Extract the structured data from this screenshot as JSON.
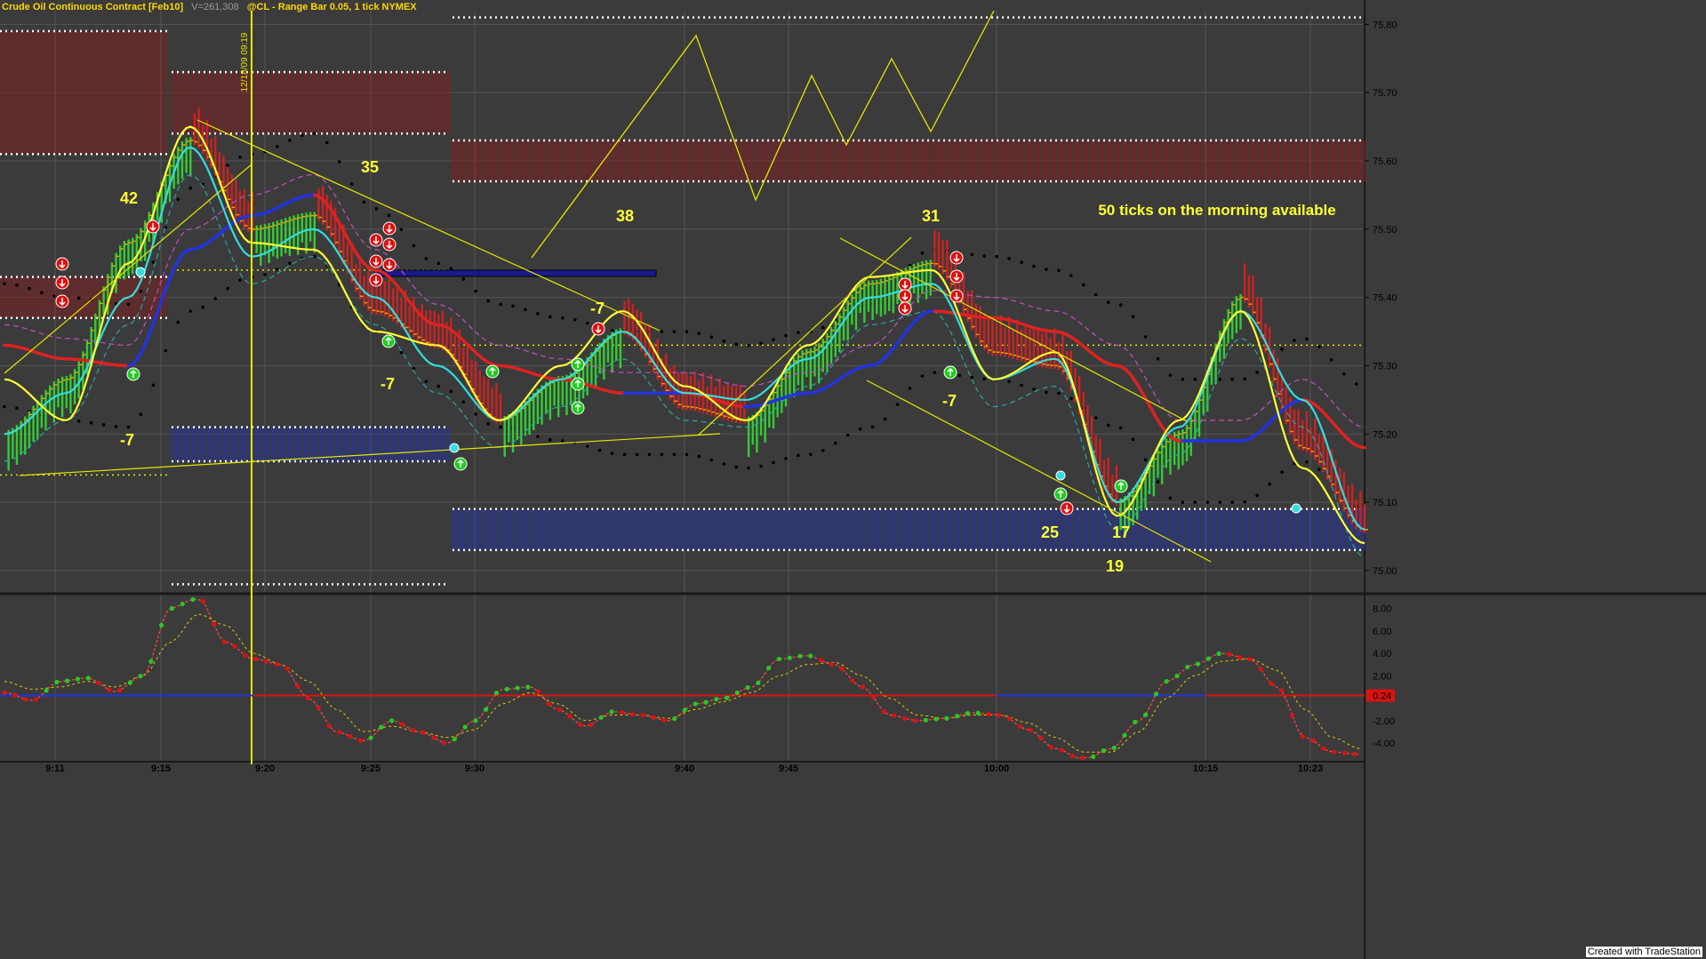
{
  "header": {
    "symbol_title": "Crude Oil Continuous Contract [Feb10]",
    "volume": "V=261,308",
    "instrument": "@CL - Range Bar 0.05, 1 tick  NYMEX"
  },
  "marker_date": "12/18/09 09:19",
  "footer": "Created with TradeStation",
  "annotation": "50 ticks on the morning available",
  "colors": {
    "background": "#3b3b3b",
    "up_bar": "#33cc33",
    "down_bar": "#cc2222",
    "price_tick": "#f0a000",
    "fast_ma": "#ffff33",
    "mid_ma": "#33dddd",
    "slow_ma_up": "#2233dd",
    "slow_ma_down": "#dd2222",
    "envelope": "#000000",
    "supply_zone": "#8b1a1a",
    "demand_zone": "#2233aa",
    "trendline": "#e6e600",
    "text": "#ffff33"
  },
  "chart_data": [
    {
      "type": "candlestick",
      "title": "Crude Oil Continuous Contract [Feb10]",
      "x_ticks": [
        "9:11",
        "9:15",
        "9:20",
        "9:25",
        "9:30",
        "9:40",
        "9:45",
        "10:00",
        "10:15",
        "10:23"
      ],
      "y_ticks": [
        "75.80",
        "75.70",
        "75.60",
        "75.50",
        "75.40",
        "75.30",
        "75.20",
        "75.10",
        "75.00"
      ],
      "ylim": [
        74.97,
        75.82
      ],
      "grid": true,
      "series": [
        {
          "name": "Price",
          "x": [
            "9:11",
            "9:13",
            "9:15",
            "9:17",
            "9:19",
            "9:21",
            "9:23",
            "9:25",
            "9:28",
            "9:30",
            "9:34",
            "9:37",
            "9:40",
            "9:43",
            "9:45",
            "9:50",
            "9:55",
            "10:00",
            "10:05",
            "10:10",
            "10:15",
            "10:20",
            "10:23"
          ],
          "close": [
            75.2,
            75.28,
            75.48,
            75.63,
            75.5,
            75.52,
            75.38,
            75.33,
            75.22,
            75.28,
            75.35,
            75.24,
            75.22,
            75.32,
            75.42,
            75.45,
            75.32,
            75.3,
            75.1,
            75.2,
            75.4,
            75.18,
            75.06
          ]
        },
        {
          "name": "Fast MA",
          "values": [
            75.28,
            75.22,
            75.45,
            75.65,
            75.48,
            75.47,
            75.35,
            75.33,
            75.22,
            75.3,
            75.38,
            75.27,
            75.22,
            75.33,
            75.43,
            75.44,
            75.28,
            75.32,
            75.08,
            75.22,
            75.38,
            75.15,
            75.04
          ]
        },
        {
          "name": "Mid MA",
          "values": [
            75.2,
            75.26,
            75.4,
            75.62,
            75.46,
            75.5,
            75.4,
            75.3,
            75.22,
            75.28,
            75.35,
            75.26,
            75.25,
            75.31,
            75.4,
            75.42,
            75.28,
            75.31,
            75.1,
            75.21,
            75.38,
            75.25,
            75.06
          ]
        },
        {
          "name": "Slow MA",
          "values": [
            75.33,
            75.31,
            75.3,
            75.47,
            75.52,
            75.55,
            75.44,
            75.36,
            75.3,
            75.28,
            75.26,
            75.26,
            75.24,
            75.26,
            75.3,
            75.38,
            75.37,
            75.35,
            75.3,
            75.19,
            75.19,
            75.25,
            75.18
          ]
        }
      ],
      "zones": [
        {
          "kind": "supply",
          "range": [
            75.61,
            75.79
          ]
        },
        {
          "kind": "supply",
          "range": [
            75.64,
            75.73
          ]
        },
        {
          "kind": "supply",
          "range": [
            75.57,
            75.63
          ]
        },
        {
          "kind": "supply",
          "range": [
            75.37,
            75.43
          ]
        },
        {
          "kind": "demand",
          "range": [
            75.16,
            75.21
          ]
        },
        {
          "kind": "demand",
          "range": [
            75.03,
            75.09
          ]
        }
      ],
      "annotations": [
        "42",
        "35",
        "38",
        "31",
        "-7",
        "-7",
        "-7",
        "-7",
        "25",
        "17",
        "19",
        "50 ticks on the morning available"
      ]
    },
    {
      "type": "line",
      "title": "",
      "y_ticks": [
        "8.00",
        "6.00",
        "4.00",
        "2.00",
        "0.24",
        "-2.00",
        "-4.00"
      ],
      "ylim": [
        -5.5,
        9
      ],
      "zero_line": 0.24,
      "series": [
        {
          "name": "Oscillator",
          "values": [
            0.5,
            -0.2,
            1.5,
            1.8,
            0.6,
            2.0,
            8.0,
            9.0,
            5.0,
            3.5,
            3.0,
            0.0,
            -3.0,
            -3.8,
            -2.0,
            -3.0,
            -4.0,
            -2.0,
            0.8,
            1.0,
            -1.0,
            -2.5,
            -1.2,
            -1.5,
            -2.0,
            -0.5,
            0.0,
            1.0,
            3.5,
            3.8,
            3.0,
            1.0,
            -1.5,
            -2.0,
            -1.8,
            -1.3,
            -1.5,
            -2.8,
            -4.5,
            -5.5,
            -4.5,
            -2.0,
            1.5,
            3.0,
            4.0,
            3.5,
            1.0,
            -3.5,
            -4.8,
            -5.0
          ]
        },
        {
          "name": "Signal",
          "values": [
            1.5,
            0.8,
            1.0,
            1.5,
            1.0,
            2.0,
            5.0,
            7.5,
            6.5,
            4.0,
            3.0,
            1.5,
            -1.0,
            -3.0,
            -2.5,
            -3.0,
            -3.5,
            -2.8,
            -0.5,
            0.5,
            -0.5,
            -2.0,
            -1.5,
            -1.5,
            -1.8,
            -1.0,
            -0.3,
            0.5,
            2.0,
            3.0,
            3.2,
            2.0,
            0.0,
            -1.5,
            -1.8,
            -1.5,
            -1.5,
            -2.2,
            -3.5,
            -4.8,
            -4.8,
            -3.0,
            0.0,
            2.0,
            3.3,
            3.5,
            2.5,
            -1.0,
            -3.5,
            -4.5
          ]
        }
      ]
    }
  ]
}
